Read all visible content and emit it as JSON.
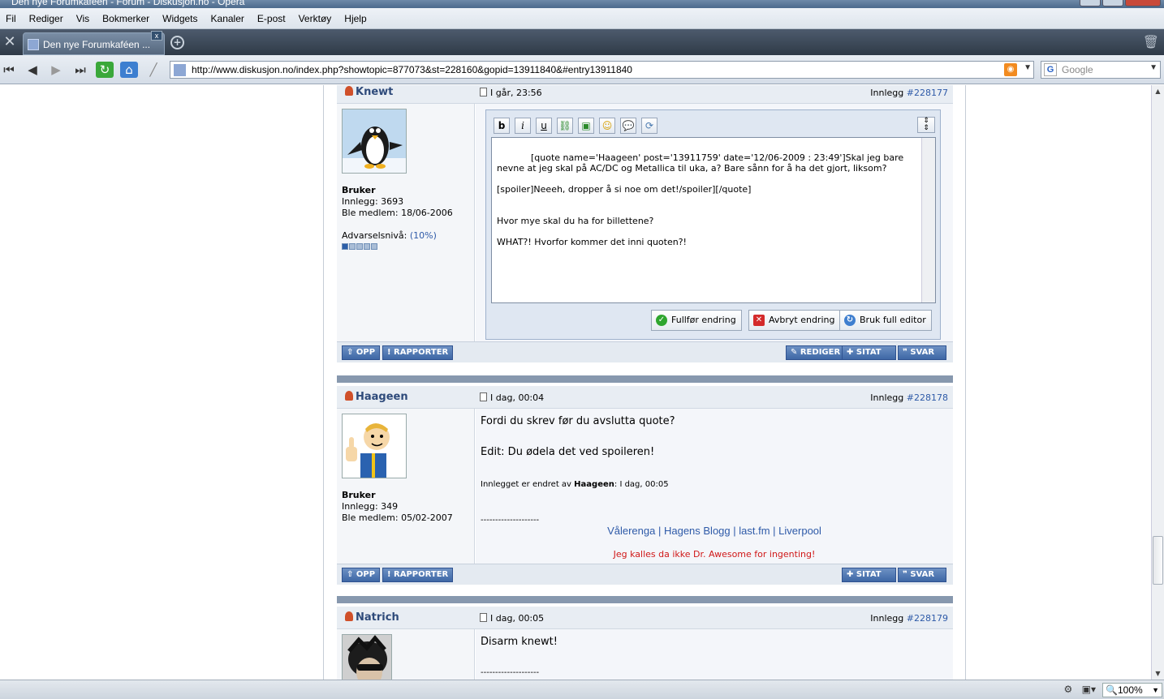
{
  "window": {
    "title": "Den nye Forumkaféen - Forum - Diskusjon.no - Opera"
  },
  "menu": [
    "Fil",
    "Rediger",
    "Vis",
    "Bokmerker",
    "Widgets",
    "Kanaler",
    "E-post",
    "Verktøy",
    "Hjelp"
  ],
  "tab": {
    "label": "Den nye Forumkaféen ...",
    "close": "x"
  },
  "address": {
    "url": "http://www.diskusjon.no/index.php?showtopic=877073&st=228160&gopid=13911840&#entry13911840",
    "search_placeholder": "Google"
  },
  "buttons": {
    "opp": "⇧ OPP",
    "rapporter": "! RAPPORTER",
    "rediger": "✎ REDIGER",
    "sitat": "✚ SITAT",
    "svar": "❞ SVAR"
  },
  "posts": [
    {
      "author": "Knewt",
      "date": "I går, 23:56",
      "post_label": "Innlegg",
      "post_number": "#228177",
      "group": "Bruker",
      "posts_count": "Innlegg: 3693",
      "member_since": "Ble medlem: 18/06-2006",
      "warning_label": "Advarselsnivå:",
      "warning_value": "(10%)",
      "editor_text": "[quote name='Haageen' post='13911759' date='12/06-2009 : 23:49']Skal jeg bare nevne at jeg skal på AC/DC og Metallica til uka, a? Bare sånn for å ha det gjort, liksom?\n\n[spoiler]Neeeh, dropper å si noe om det!/spoiler][/quote]\n\n\nHvor mye skal du ha for billettene?\n\nWHAT?! Hvorfor kommer det inni quoten?!",
      "editor_buttons": {
        "finish": "Fullfør endring",
        "cancel": "Avbryt endring",
        "full_editor": "Bruk full editor"
      }
    },
    {
      "author": "Haageen",
      "date": "I dag, 00:04",
      "post_label": "Innlegg",
      "post_number": "#228178",
      "group": "Bruker",
      "posts_count": "Innlegg: 349",
      "member_since": "Ble medlem: 05/02-2007",
      "line1": "Fordi du skrev før du avslutta quote?",
      "line2": "Edit: Du ødela det ved spoileren!",
      "edited_prefix": "Innlegget er endret av",
      "edited_by": "Haageen",
      "edited_suffix": ": I dag, 00:05",
      "signature_sep": "--------------------",
      "sig_links": [
        "Vålerenga",
        "Hagens Blogg",
        "last.fm",
        "Liverpool"
      ],
      "sig_quote": "Jeg kalles da ikke Dr. Awesome for ingenting!"
    },
    {
      "author": "Natrich",
      "date": "I dag, 00:05",
      "post_label": "Innlegg",
      "post_number": "#228179",
      "line1": "Disarm knewt!",
      "signature_sep": "--------------------"
    }
  ],
  "status": {
    "zoom": "100%"
  }
}
